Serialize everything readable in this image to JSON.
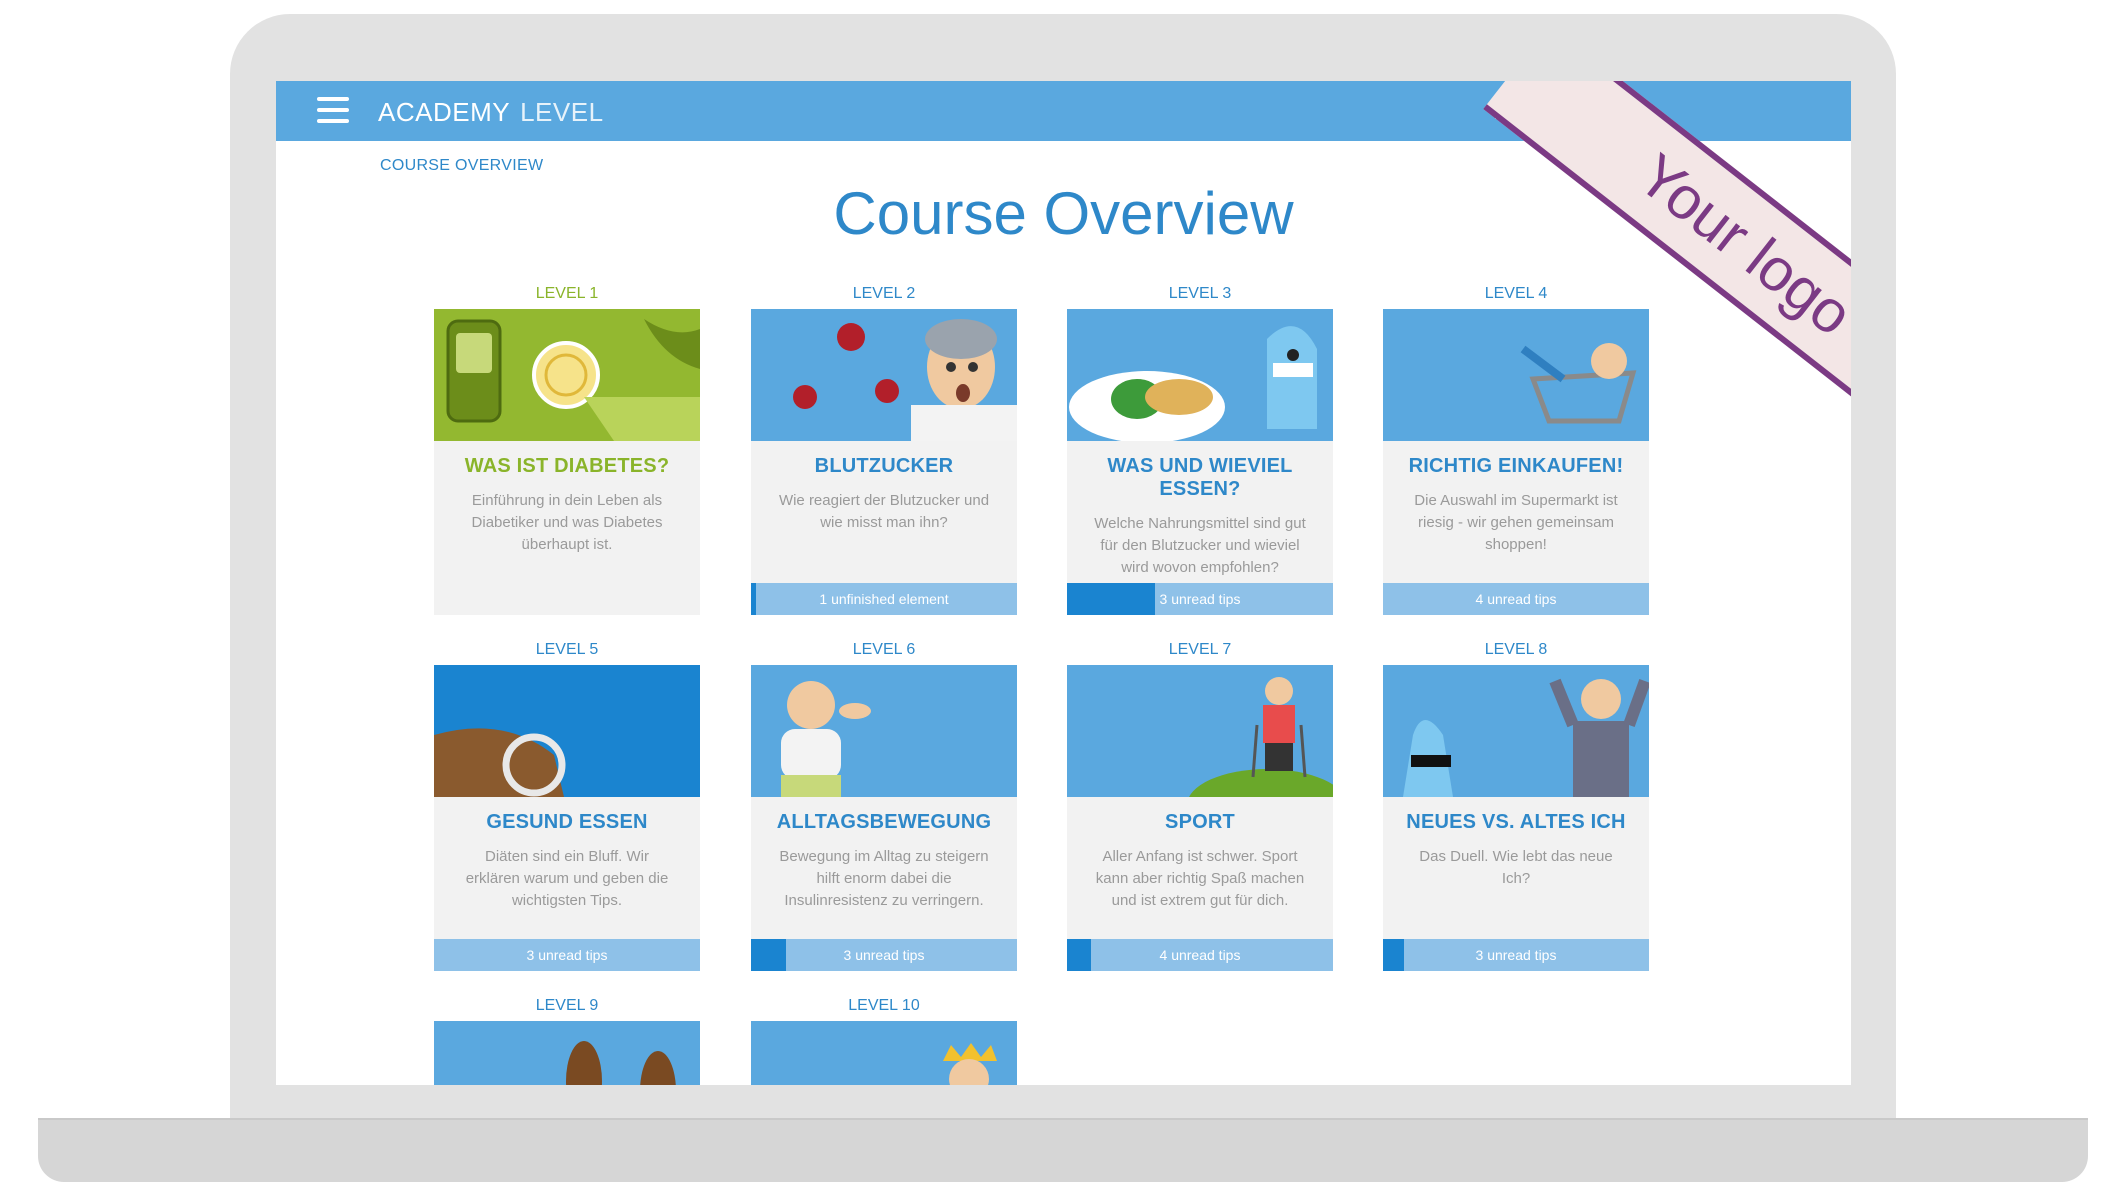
{
  "app": {
    "brand": "ACADEMY",
    "brand_sub": "LEVEL"
  },
  "breadcrumb": "COURSE OVERVIEW",
  "page_title": "Course Overview",
  "ribbon": "Your logo",
  "levels": [
    {
      "label": "LEVEL 1",
      "title": "WAS IST DIABETES?",
      "desc": "Einführung in dein Leben als Diabetiker und was Diabetes überhaupt ist.",
      "status": "",
      "progress": 0
    },
    {
      "label": "LEVEL 2",
      "title": "BLUTZUCKER",
      "desc": "Wie reagiert der Blutzucker und wie misst man ihn?",
      "status": "1 unfinished element",
      "progress": 0.02
    },
    {
      "label": "LEVEL 3",
      "title": "WAS UND WIEVIEL ESSEN?",
      "desc": "Welche Nahrungsmittel sind gut für den Blutzucker und wieviel wird wovon empfohlen?",
      "status": "3 unread tips",
      "progress": 0.33
    },
    {
      "label": "LEVEL 4",
      "title": "RICHTIG EINKAUFEN!",
      "desc": "Die Auswahl im Supermarkt ist riesig - wir gehen gemeinsam shoppen!",
      "status": "4 unread tips",
      "progress": 0
    },
    {
      "label": "LEVEL 5",
      "title": "GESUND ESSEN",
      "desc": "Diäten sind ein Bluff. Wir erklären warum und geben die wichtigsten Tips.",
      "status": "3 unread tips",
      "progress": 0
    },
    {
      "label": "LEVEL 6",
      "title": "ALLTAGSBEWEGUNG",
      "desc": "Bewegung im Alltag zu steigern hilft enorm dabei die Insulinresistenz zu verringern.",
      "status": "3 unread tips",
      "progress": 0.13
    },
    {
      "label": "LEVEL 7",
      "title": "SPORT",
      "desc": "Aller Anfang ist schwer. Sport kann aber richtig Spaß machen und ist extrem gut für dich.",
      "status": "4 unread tips",
      "progress": 0.09
    },
    {
      "label": "LEVEL 8",
      "title": "NEUES VS. ALTES ICH",
      "desc": "Das Duell. Wie lebt das neue Ich?",
      "status": "3 unread tips",
      "progress": 0.08
    },
    {
      "label": "LEVEL 9",
      "title": "",
      "desc": "",
      "status": "",
      "progress": 0
    },
    {
      "label": "LEVEL 10",
      "title": "",
      "desc": "",
      "status": "",
      "progress": 0
    }
  ],
  "colors": {
    "accent": "#5aa8df",
    "title": "#2e88c9",
    "level1": "#8ab42a",
    "ribbon": "#7b3a84"
  }
}
